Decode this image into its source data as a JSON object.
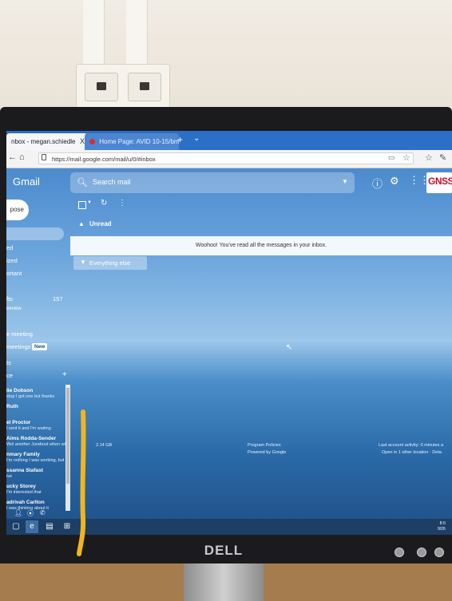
{
  "browser": {
    "tabs": [
      {
        "label": "nbox - megan.schiedle"
      },
      {
        "label": "Home Page: AVID 10-15/bm"
      }
    ],
    "tab_close": "X",
    "new_tab": "+",
    "tab_menu": "⌄",
    "url": "https://mail.google.com/mail/u/0/#inbox"
  },
  "gmail": {
    "logo": "Gmail",
    "search_placeholder": "Search mail",
    "compose_label": "pose",
    "org_logo": "GNSS",
    "sidebar": [
      {
        "label": "ed"
      },
      {
        "label": "ized"
      },
      {
        "label": "ortant"
      },
      {
        "label": "fts",
        "count": "157"
      },
      {
        "label": "eeview"
      },
      {
        "label": "e meeting"
      },
      {
        "label": "meetings"
      },
      {
        "label": "ts"
      },
      {
        "label": "ce"
      }
    ],
    "new_badge": "New",
    "chat_list": [
      {
        "name": "lie Dobson",
        "preview": "stop I got one but thanks"
      },
      {
        "name": "Ruth"
      },
      {
        "name": "el Proctor",
        "preview": "I sent it and I'm waiting"
      },
      {
        "name": "Aims Rodda-Sender",
        "preview": "Wel another Jurabout when will"
      },
      {
        "name": "nmary Family",
        "preview": "t'm nothing I was working, but"
      },
      {
        "name": "ssanna Stafast",
        "preview": "ive"
      },
      {
        "name": "ucky Storey",
        "preview": "I'm interested that"
      },
      {
        "name": "adrivah Carlton",
        "preview": "I was thinking about it"
      }
    ],
    "unread_section": "Unread",
    "unread_empty": "Woohoo! You've read all the messages in your inbox.",
    "everything_else": "Everything else",
    "footer": {
      "storage": "2.14 GB",
      "policies": "Program Policies",
      "powered": "Powered by Google",
      "activity": "Last account activity: 0 minutes a",
      "open": "Open in 1 other location · Deta"
    }
  },
  "taskbar": {
    "clock_lines": [
      "8:0",
      "9/26"
    ]
  },
  "monitor": {
    "brand": "DELL"
  }
}
